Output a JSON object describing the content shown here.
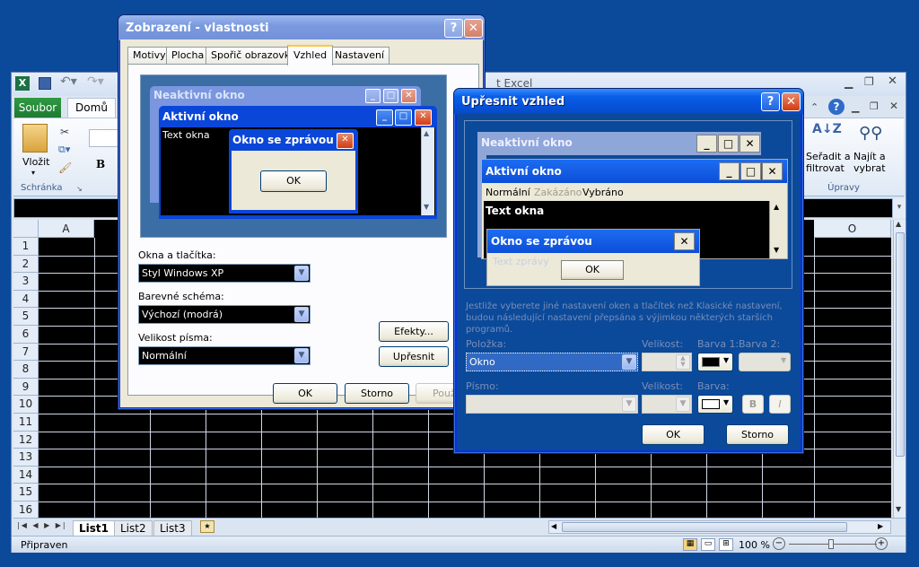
{
  "excel": {
    "title_partial": "t Excel",
    "tab_file": "Soubor",
    "tab_home": "Domů",
    "paste_label": "Vložit",
    "clipboard_group": "Schránka",
    "bold_label": "B",
    "sort_filter_label": "Seřadit a filtrovat",
    "find_select_label": "Najít a vybrat",
    "edit_group": "Úpravy",
    "col_a": "A",
    "col_o": "O",
    "rows": [
      "1",
      "2",
      "3",
      "4",
      "5",
      "6",
      "7",
      "8",
      "9",
      "10",
      "11",
      "12",
      "13",
      "14",
      "15",
      "16"
    ],
    "sheets": [
      "List1",
      "List2",
      "List3"
    ],
    "status": "Připraven",
    "zoom": "100 %"
  },
  "display_dialog": {
    "title": "Zobrazení - vlastnosti",
    "help_btn": "?",
    "close_btn": "✕",
    "tabs": [
      "Motivy",
      "Plocha",
      "Spořič obrazovky",
      "Vzhled",
      "Nastavení"
    ],
    "preview": {
      "inactive_title": "Neaktivní okno",
      "active_title": "Aktivní okno",
      "window_text": "Text okna",
      "msgbox_title": "Okno se zprávou",
      "ok": "OK"
    },
    "windows_buttons_label": "Okna a tlačítka:",
    "windows_buttons_value": "Styl Windows XP",
    "color_scheme_label": "Barevné schéma:",
    "color_scheme_value": "Výchozí (modrá)",
    "font_size_label": "Velikost písma:",
    "font_size_value": "Normální",
    "effects_btn": "Efekty...",
    "advanced_btn": "Upřesnit",
    "ok_btn": "OK",
    "cancel_btn": "Storno",
    "apply_btn": "Použ"
  },
  "advanced_dialog": {
    "title": "Upřesnit vzhled",
    "help_btn": "?",
    "close_btn": "✕",
    "preview": {
      "inactive_title": "Neaktivní okno",
      "active_title": "Aktivní okno",
      "menu_normal": "Normální",
      "menu_disabled": "Zakázáno",
      "menu_selected": "Vybráno",
      "window_text": "Text okna",
      "msgbox_title": "Okno se zprávou",
      "msgbox_text": "Text zprávy",
      "ok": "OK"
    },
    "info_text": "Jestliže vyberete jiné nastavení oken a tlačítek než Klasické nastavení, budou následující nastavení přepsána s výjimkou některých starších programů.",
    "item_label": "Položka:",
    "item_value": "Okno",
    "size_label": "Velikost:",
    "color1_label": "Barva 1:",
    "color2_label": "Barva 2:",
    "font_label": "Písmo:",
    "size2_label": "Velikost:",
    "color_label": "Barva:",
    "bold_btn": "B",
    "italic_btn": "I",
    "ok_btn": "OK",
    "cancel_btn": "Storno"
  }
}
